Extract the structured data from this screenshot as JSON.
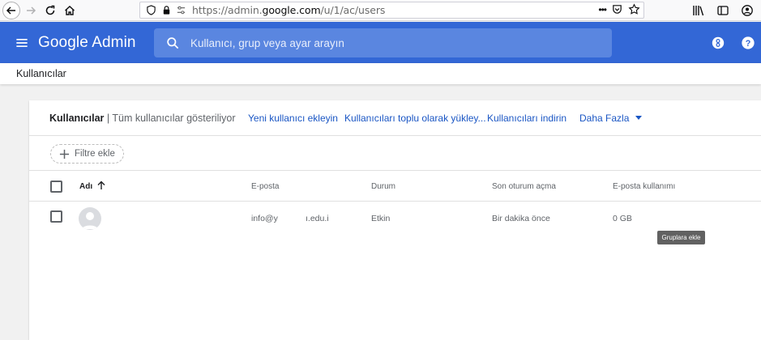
{
  "browser": {
    "url_prefix": "https://admin.",
    "url_domain": "google.com",
    "url_path": "/u/1/ac/users",
    "url_more": "•••"
  },
  "header": {
    "title": "Google Admin",
    "search_placeholder": "Kullanıcı, grup veya ayar arayın",
    "brand_color": "#3367d6"
  },
  "breadcrumb": {
    "label": "Kullanıcılar"
  },
  "card": {
    "title": "Kullanıcılar",
    "separator": "|",
    "subtitle": "Tüm kullanıcılar gösteriliyor",
    "actions": {
      "add_user": "Yeni kullanıcı ekleyin",
      "bulk_upload": "Kullanıcıları toplu olarak yükley...",
      "download": "Kullanıcıları indirin",
      "more": "Daha Fazla"
    }
  },
  "filter": {
    "add_label": "Filtre ekle"
  },
  "table": {
    "columns": {
      "name": "Adı",
      "email": "E-posta",
      "status": "Durum",
      "last_login": "Son oturum açma",
      "storage": "E-posta kullanımı"
    },
    "rows": [
      {
        "name": "",
        "email_start": "info@y",
        "email_end": "ı.edu.i",
        "status": "Etkin",
        "last_login": "Bir dakika önce",
        "storage": "0 GB"
      }
    ]
  },
  "tooltip": {
    "text": "Gruplara ekle"
  }
}
